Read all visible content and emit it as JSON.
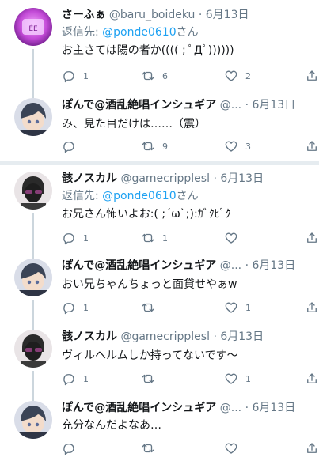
{
  "tweets": [
    {
      "name": "さーふぁ",
      "handle": "@baru_boideku",
      "dot": "·",
      "date": "6月13日",
      "reply_prefix": "返信先: ",
      "reply_to": "@ponde0610",
      "reply_suffix": "さん",
      "text": "お主さては陽の者か(((( ; ﾟДﾟ))))))",
      "replies": "1",
      "retweets": "6",
      "likes": "2",
      "avatar_color": "#c94ad9"
    },
    {
      "name": "ぽんで@酒乱絶唱インシュギア",
      "handle": "@...",
      "dot": "·",
      "date": "6月13日",
      "text": "み、見た目だけは……（震）",
      "replies": "",
      "retweets": "9",
      "likes": "3",
      "avatar_color": "#4a5a7a"
    },
    {
      "name": "骸ノスカル",
      "handle": "@gamecripplesl",
      "dot": "·",
      "date": "6月13日",
      "reply_prefix": "返信先: ",
      "reply_to": "@ponde0610",
      "reply_suffix": "さん",
      "text": "お兄さん怖いよお:( ;´ω`;):ｶﾞｸﾋﾟｸ",
      "replies": "1",
      "retweets": "1",
      "likes": "",
      "avatar_color": "#3a3a3a"
    },
    {
      "name": "ぽんで@酒乱絶唱インシュギア",
      "handle": "@...",
      "dot": "·",
      "date": "6月13日",
      "text": "おい兄ちゃんちょっと面貸せやぁw",
      "replies": "1",
      "retweets": "",
      "likes": "1",
      "avatar_color": "#4a5a7a"
    },
    {
      "name": "骸ノスカル",
      "handle": "@gamecripplesl",
      "dot": "·",
      "date": "6月13日",
      "text": "ヴィルヘルムしか持ってないです〜",
      "replies": "1",
      "retweets": "",
      "likes": "1",
      "avatar_color": "#3a3a3a"
    },
    {
      "name": "ぽんで@酒乱絶唱インシュギア",
      "handle": "@...",
      "dot": "·",
      "date": "6月13日",
      "text": "充分なんだよなあ…",
      "replies": "",
      "retweets": "",
      "likes": "",
      "avatar_color": "#4a5a7a"
    }
  ]
}
